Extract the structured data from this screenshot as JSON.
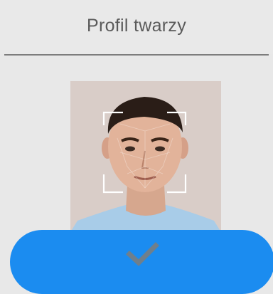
{
  "header": {
    "title": "Profil twarzy"
  },
  "photo": {
    "icon": "face-scan-frame-icon"
  },
  "confirm": {
    "icon": "checkmark-icon",
    "color": "#1b8cf0"
  },
  "colors": {
    "background": "#e8e8e8",
    "title_text": "#5a5a5a",
    "divider": "#7d7d7d"
  }
}
